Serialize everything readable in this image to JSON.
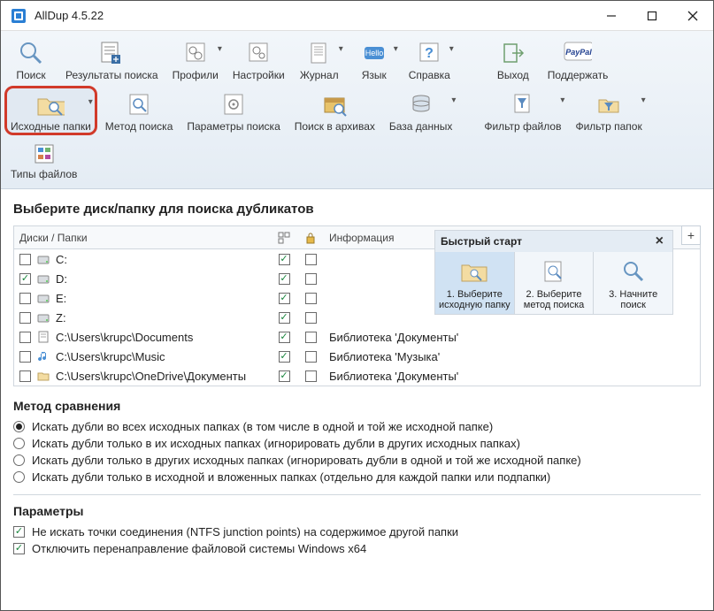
{
  "window": {
    "title": "AllDup 4.5.22"
  },
  "toolbar_top": {
    "search": "Поиск",
    "results": "Результаты поиска",
    "profiles": "Профили",
    "settings": "Настройки",
    "log": "Журнал",
    "language": "Язык",
    "help": "Справка",
    "exit": "Выход",
    "support": "Поддержать"
  },
  "toolbar_mid": {
    "source_folders": "Исходные папки",
    "search_method": "Метод поиска",
    "search_params": "Параметры поиска",
    "archive_search": "Поиск в архивах",
    "database": "База данных",
    "file_filter": "Фильтр файлов",
    "folder_filter": "Фильтр папок"
  },
  "toolbar_low": {
    "file_types": "Типы файлов"
  },
  "main_heading": "Выберите диск/папку для поиска дубликатов",
  "columns": {
    "disks": "Диски / Папки",
    "info": "Информация"
  },
  "rows": [
    {
      "checked": false,
      "kind": "disk",
      "label": "C:",
      "c1": true,
      "c2": false,
      "info": ""
    },
    {
      "checked": true,
      "kind": "disk",
      "label": "D:",
      "c1": true,
      "c2": false,
      "info": ""
    },
    {
      "checked": false,
      "kind": "disk",
      "label": "E:",
      "c1": true,
      "c2": false,
      "info": ""
    },
    {
      "checked": false,
      "kind": "disk",
      "label": "Z:",
      "c1": true,
      "c2": false,
      "info": ""
    },
    {
      "checked": false,
      "kind": "folder-doc",
      "label": "C:\\Users\\krupc\\Documents",
      "c1": true,
      "c2": false,
      "info": "Библиотека 'Документы'"
    },
    {
      "checked": false,
      "kind": "folder-music",
      "label": "C:\\Users\\krupc\\Music",
      "c1": true,
      "c2": false,
      "info": "Библиотека 'Музыка'"
    },
    {
      "checked": false,
      "kind": "folder",
      "label": "C:\\Users\\krupc\\OneDrive\\Документы",
      "c1": true,
      "c2": false,
      "info": "Библиотека 'Документы'"
    }
  ],
  "quick": {
    "title": "Быстрый старт",
    "s1": "1. Выберите исходную папку",
    "s2": "2. Выберите метод поиска",
    "s3": "3. Начните поиск"
  },
  "method": {
    "title": "Метод сравнения",
    "o1": "Искать дубли во всех исходных папках (в том числе в одной и той же исходной папке)",
    "o2": "Искать дубли только в их исходных папках (игнорировать дубли в других исходных папках)",
    "o3": "Искать дубли только в других исходных папках (игнорировать дубли в одной и той же исходной папке)",
    "o4": "Искать дубли только в исходной и вложенных папках (отдельно для каждой папки или подпапки)"
  },
  "params": {
    "title": "Параметры",
    "p1": "Не искать точки соединения (NTFS junction points) на содержимое другой папки",
    "p2": "Отключить перенаправление файловой системы Windows x64"
  }
}
